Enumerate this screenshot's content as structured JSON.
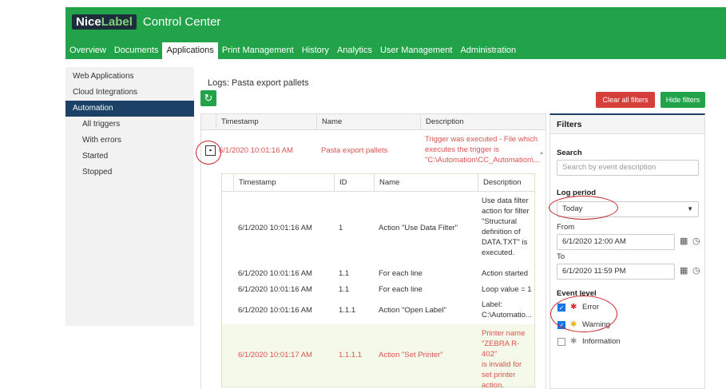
{
  "header": {
    "logo_part1": "Nice",
    "logo_part2": "Label",
    "title": "Control Center",
    "nav": [
      "Overview",
      "Documents",
      "Applications",
      "Print Management",
      "History",
      "Analytics",
      "User Management",
      "Administration"
    ],
    "active_nav": "Applications"
  },
  "sidebar": {
    "items": [
      {
        "label": "Web Applications",
        "active": false,
        "sub": false
      },
      {
        "label": "Cloud Integrations",
        "active": false,
        "sub": false
      },
      {
        "label": "Automation",
        "active": true,
        "sub": false
      },
      {
        "label": "All triggers",
        "active": false,
        "sub": true
      },
      {
        "label": "With errors",
        "active": false,
        "sub": true
      },
      {
        "label": "Started",
        "active": false,
        "sub": true
      },
      {
        "label": "Stopped",
        "active": false,
        "sub": true
      }
    ]
  },
  "main": {
    "title": "Logs: Pasta export pallets",
    "refresh_icon": "refresh-icon",
    "clear_filters_label": "Clear all filters",
    "hide_filters_label": "Hide filters"
  },
  "log_table": {
    "headers": [
      "Timestamp",
      "Name",
      "Description"
    ],
    "row": {
      "expand_icon": "expand-collapse-icon",
      "timestamp": "6/1/2020 10:01:16 AM",
      "name": "Pasta export pallets",
      "description_lines": [
        "Trigger was executed - File which",
        "executes the trigger is",
        "\"C:\\Automation\\CC_Automation\\..."
      ]
    },
    "sub_headers": [
      "Timestamp",
      "ID",
      "Name",
      "Description"
    ],
    "sub_rows": [
      {
        "timestamp": "6/1/2020 10:01:16 AM",
        "id": "1",
        "name": "Action \"Use Data Filter\"",
        "description": [
          "Use data filter",
          "action for filter",
          "\"Structural",
          "definition of",
          "DATA.TXT\" is",
          "executed."
        ],
        "error": false
      },
      {
        "timestamp": "6/1/2020 10:01:16 AM",
        "id": "1.1",
        "name": "For each line",
        "description": [
          "Action started"
        ],
        "error": false
      },
      {
        "timestamp": "6/1/2020 10:01:16 AM",
        "id": "1.1",
        "name": "For each line",
        "description": [
          "Loop value = 1"
        ],
        "error": false
      },
      {
        "timestamp": "6/1/2020 10:01:16 AM",
        "id": "1.1.1",
        "name": "Action \"Open Label\"",
        "description": [
          "Label:",
          "C:\\Automatio..."
        ],
        "error": false
      },
      {
        "timestamp": "6/1/2020 10:01:17 AM",
        "id": "1.1.1.1",
        "name": "Action \"Set Printer\"",
        "description": [
          "Printer name",
          "\"ZEBRA R-402\"",
          "is invalid for",
          "set printer",
          "action."
        ],
        "error": true
      }
    ]
  },
  "filters": {
    "title": "Filters",
    "search_label": "Search",
    "search_placeholder": "Search by event description",
    "log_period_label": "Log period",
    "log_period_value": "Today",
    "from_label": "From",
    "from_value": "6/1/2020 12:00 AM",
    "to_label": "To",
    "to_value": "6/1/2020 11:59 PM",
    "event_level_label": "Event level",
    "levels": [
      {
        "label": "Error",
        "checked": true,
        "icon": "error-asterisk-icon",
        "color": "#d9262c"
      },
      {
        "label": "Warning",
        "checked": true,
        "icon": "warning-asterisk-icon",
        "color": "#f0b400"
      },
      {
        "label": "Information",
        "checked": false,
        "icon": "info-asterisk-icon",
        "color": "#999999"
      }
    ]
  },
  "colors": {
    "brand_green": "#22a349",
    "navy": "#1b4166",
    "error_red": "#d9534f"
  }
}
